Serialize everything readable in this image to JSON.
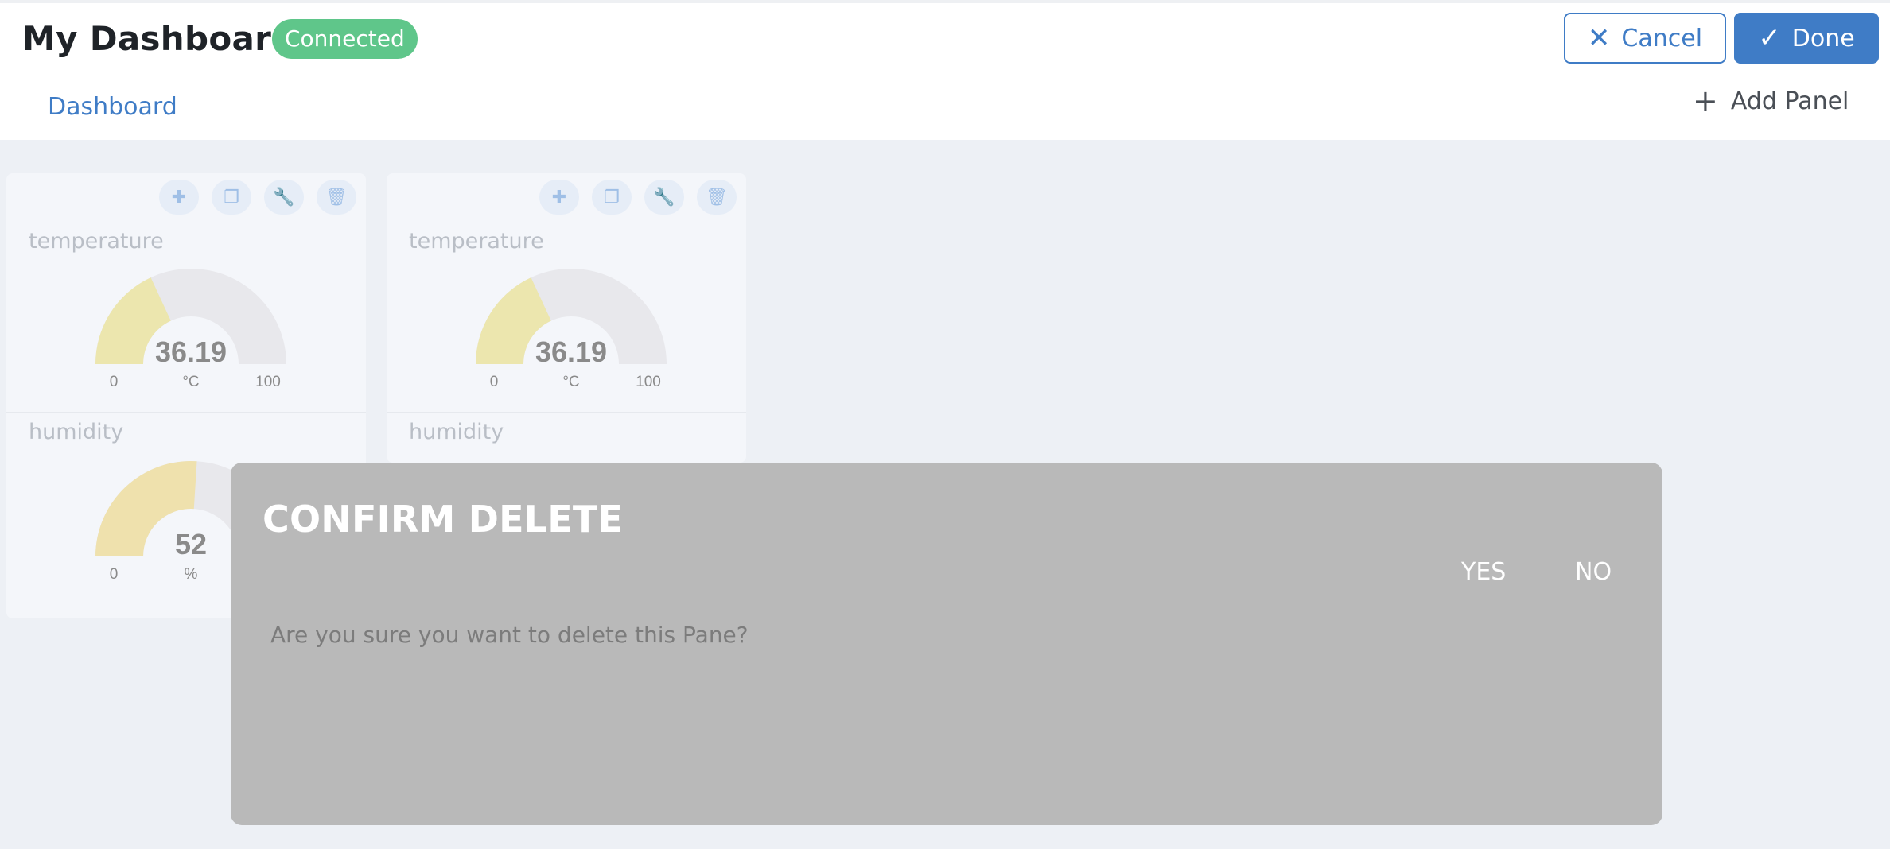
{
  "header": {
    "title": "My Dashboard",
    "status_badge": "Connected",
    "cancel_label": "Cancel",
    "done_label": "Done",
    "tab_label": "Dashboard",
    "add_panel_label": "Add Panel"
  },
  "panes": [
    {
      "widgets": [
        {
          "title": "temperature",
          "value": "36.19",
          "unit": "°C",
          "min": "0",
          "max": "100",
          "fraction": 0.3619,
          "color": "#ece6ae"
        },
        {
          "title": "humidity",
          "value": "52",
          "unit": "%",
          "min": "0",
          "max": "",
          "fraction": 0.52,
          "color": "#efe1ad"
        }
      ]
    },
    {
      "widgets": [
        {
          "title": "temperature",
          "value": "36.19",
          "unit": "°C",
          "min": "0",
          "max": "100",
          "fraction": 0.3619,
          "color": "#ece6ae"
        },
        {
          "title": "humidity"
        }
      ]
    }
  ],
  "icons": {
    "add": "plus-icon",
    "duplicate": "copy-icon",
    "settings": "wrench-icon",
    "delete": "trash-icon"
  },
  "colors": {
    "accent": "#3f7cc6",
    "badge": "#5fc68a",
    "modal": "#b9b9b9",
    "gauge_track": "#e8e8ec"
  },
  "modal": {
    "title": "CONFIRM DELETE",
    "yes_label": "YES",
    "no_label": "NO",
    "message": "Are you sure you want to delete this Pane?"
  }
}
